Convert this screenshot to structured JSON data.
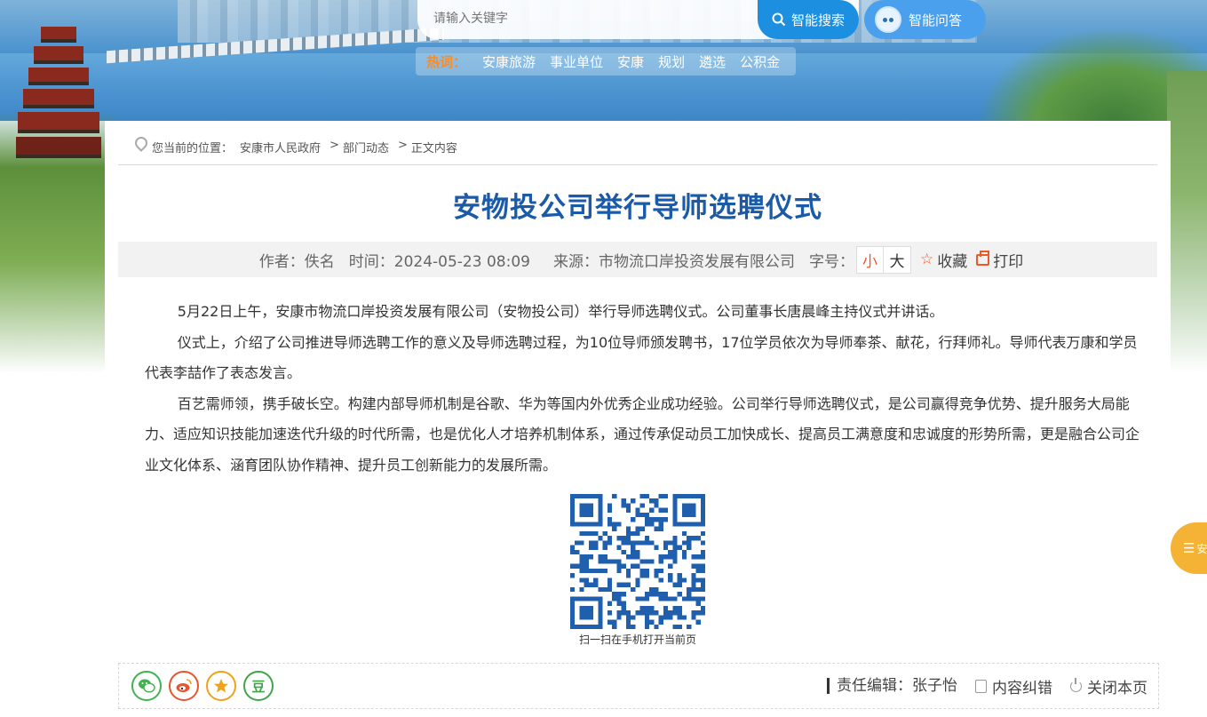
{
  "search": {
    "placeholder": "请输入关键字",
    "search_button": "智能搜索",
    "qa_button": "智能问答"
  },
  "hot": {
    "label": "热词：",
    "words": [
      "安康旅游",
      "事业单位",
      "安康",
      "规划",
      "遴选",
      "公积金"
    ]
  },
  "breadcrumb": {
    "prefix": "您当前的位置：",
    "items": [
      "安康市人民政府",
      "部门动态",
      "正文内容"
    ],
    "separator": ">"
  },
  "article": {
    "title": "安物投公司举行导师选聘仪式",
    "author": "作者：佚名",
    "time": "时间：2024-05-23 08:09",
    "source": "来源：市物流口岸投资发展有限公司",
    "font_size_label": "字号：",
    "font_small": "小",
    "font_large": "大",
    "favorite": "收藏",
    "print": "打印",
    "paragraphs": [
      "5月22日上午，安康市物流口岸投资发展有限公司（安物投公司）举行导师选聘仪式。公司董事长唐晨峰主持仪式并讲话。",
      "仪式上，介绍了公司推进导师选聘工作的意义及导师选聘过程，为10位导师颁发聘书，17位学员依次为导师奉茶、献花，行拜师礼。导师代表万康和学员代表李喆作了表态发言。",
      "百艺需师领，携手破长空。构建内部导师机制是谷歌、华为等国内外优秀企业成功经验。公司举行导师选聘仪式，是公司赢得竞争优势、提升服务大局能力、适应知识技能加速迭代升级的时代所需，也是优化人才培养机制体系，通过传承促动员工加快成长、提高员工满意度和忠诚度的形势所需，更是融合公司企业文化体系、涵育团队协作精神、提升员工创新能力的发展所需。"
    ],
    "qr_caption": "扫一扫在手机打开当前页"
  },
  "footer": {
    "share_icons": [
      "wechat-icon",
      "weibo-icon",
      "qzone-icon",
      "douban-icon"
    ],
    "douban_glyph": "豆",
    "editor": "责任编辑：张子怡",
    "correction": "内容纠错",
    "close": "关闭本页"
  },
  "side_tab": {
    "label": "安"
  },
  "colors": {
    "title": "#1a5aa8",
    "accent": "#e85a2a",
    "search_button": "#1d8fe0",
    "hot_label": "#ff8a1f"
  }
}
